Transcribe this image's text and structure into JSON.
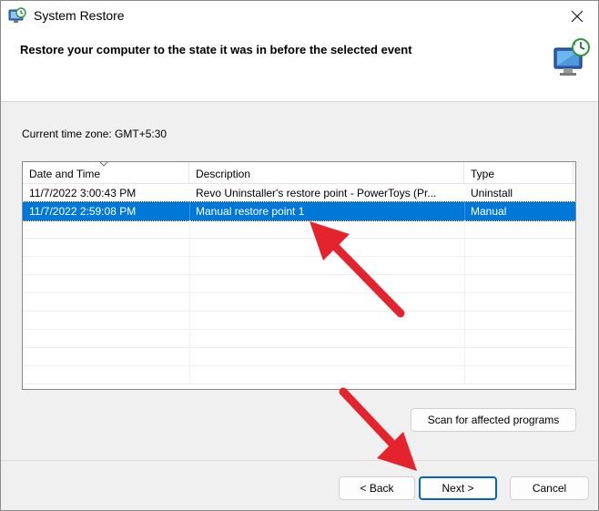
{
  "window": {
    "title": "System Restore",
    "icon": "system-restore-icon"
  },
  "header": {
    "title": "Restore your computer to the state it was in before the selected event",
    "graphic": "restore-monitor-icon"
  },
  "timezone": "Current time zone: GMT+5:30",
  "table": {
    "columns": [
      "Date and Time",
      "Description",
      "Type"
    ],
    "rows": [
      {
        "date": "11/7/2022 3:00:43 PM",
        "description": "Revo Uninstaller's restore point - PowerToys (Pr...",
        "type": "Uninstall",
        "selected": false
      },
      {
        "date": "11/7/2022 2:59:08 PM",
        "description": "Manual restore point 1",
        "type": "Manual",
        "selected": true
      }
    ]
  },
  "buttons": {
    "scan": "Scan for affected programs",
    "back": "< Back",
    "next": "Next >",
    "cancel": "Cancel"
  },
  "colors": {
    "selection": "#0078d7",
    "annotation_arrow": "#e5232c",
    "primary_border": "#0067c0"
  }
}
